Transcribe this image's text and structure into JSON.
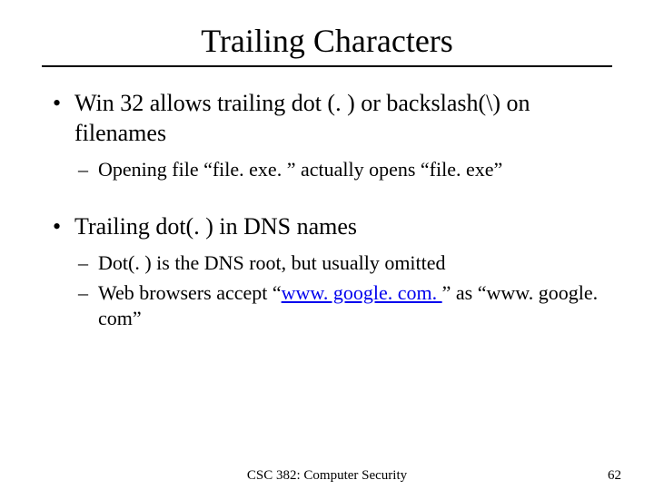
{
  "title": "Trailing Characters",
  "bullets": [
    {
      "text": "Win 32 allows trailing dot (. ) or backslash(\\) on filenames",
      "sub": [
        {
          "text": "Opening file “file. exe. ” actually opens “file. exe”"
        }
      ]
    },
    {
      "text": "Trailing dot(. ) in DNS names",
      "sub": [
        {
          "text": "Dot(. ) is the DNS root, but usually omitted"
        },
        {
          "prefix": "Web browsers accept “",
          "link": "www. google. com. ",
          "suffix": "” as “www. google. com”"
        }
      ]
    }
  ],
  "footer": {
    "course": "CSC 382: Computer Security",
    "page": "62"
  }
}
